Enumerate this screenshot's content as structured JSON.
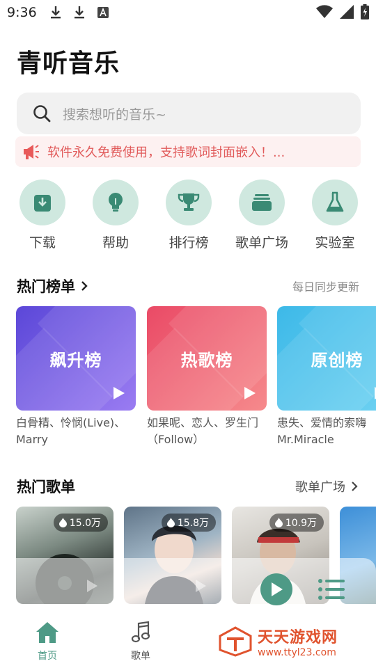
{
  "status_bar": {
    "time": "9:36"
  },
  "app_title": "青听音乐",
  "search": {
    "placeholder": "搜索想听的音乐~"
  },
  "notice": {
    "text": "软件永久免费使用，支持歌词封面嵌入！..."
  },
  "quick_actions": [
    {
      "label": "下载",
      "icon": "download-icon"
    },
    {
      "label": "帮助",
      "icon": "lightbulb-icon"
    },
    {
      "label": "排行榜",
      "icon": "trophy-icon"
    },
    {
      "label": "歌单广场",
      "icon": "stack-icon"
    },
    {
      "label": "实验室",
      "icon": "flask-icon"
    }
  ],
  "hot_charts": {
    "title": "热门榜单",
    "subtitle": "每日同步更新",
    "items": [
      {
        "name": "飙升榜",
        "desc": "白骨精、怜悯(Live)、Marry",
        "color_from": "#5b47d8",
        "color_to": "#9a7cf2"
      },
      {
        "name": "热歌榜",
        "desc": "如果呢、恋人、罗生门（Follow）",
        "color_from": "#ea4a66",
        "color_to": "#f68a8c"
      },
      {
        "name": "原创榜",
        "desc": "患失、爱情的索嗨Mr.Miracle",
        "color_from": "#3db9e8",
        "color_to": "#6fd2f2"
      }
    ]
  },
  "hot_playlists": {
    "title": "热门歌单",
    "more": "歌单广场",
    "items": [
      {
        "plays": "15.0万"
      },
      {
        "plays": "15.8万"
      },
      {
        "plays": "10.9万"
      }
    ]
  },
  "bottom_nav": [
    {
      "label": "首页",
      "icon": "home-icon",
      "active": true
    },
    {
      "label": "歌单",
      "icon": "music-note-icon",
      "active": false
    }
  ],
  "watermark": {
    "name": "天天游戏网",
    "url": "www.ttyl23.com"
  },
  "colors": {
    "accent": "#4e9a86",
    "notice": "#e15a5a",
    "icon_bg": "#cfe8df"
  }
}
